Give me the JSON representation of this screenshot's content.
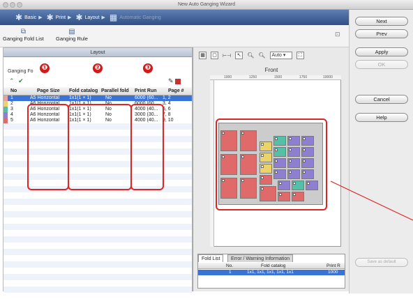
{
  "window": {
    "title": "New Auto Ganging Wizard"
  },
  "steps": [
    {
      "label": "Basic"
    },
    {
      "label": "Print"
    },
    {
      "label": "Layout"
    },
    {
      "label": "Automatic Ganging"
    }
  ],
  "toolbar": {
    "fold_list_label": "Ganging Fold List",
    "rule_label": "Ganging Rule"
  },
  "left_panel": {
    "header": "Layout",
    "section_label": "Ganging Fo"
  },
  "markers": [
    "❶",
    "❷",
    "❸"
  ],
  "table": {
    "columns": [
      "No",
      "Page Size",
      "Fold catalog",
      "Parallel fold",
      "Print Run",
      "Page #"
    ],
    "rows": [
      {
        "no": "1",
        "page_size": "A5 Horizontal",
        "fold": "1x1(1 × 1)",
        "parallel": "No",
        "run": "6000 (60...",
        "pages": "1, 2",
        "color": "#e8a0a0",
        "selected": true
      },
      {
        "no": "2",
        "page_size": "A6 Horizontal",
        "fold": "1x1(1 × 1)",
        "parallel": "No",
        "run": "6000 (60...",
        "pages": "3, 4",
        "color": "#e9d36a",
        "selected": false
      },
      {
        "no": "3",
        "page_size": "A6 Horizontal",
        "fold": "1x1(1 × 1)",
        "parallel": "No",
        "run": "4000 (40...",
        "pages": "5, 6",
        "color": "#55c0a8",
        "selected": false
      },
      {
        "no": "4",
        "page_size": "A6 Horizontal",
        "fold": "1x1(1 × 1)",
        "parallel": "No",
        "run": "3000 (30...",
        "pages": "7, 8",
        "color": "#8f7fd0",
        "selected": false
      },
      {
        "no": "5",
        "page_size": "A6 Horizontal",
        "fold": "1x1(1 × 1)",
        "parallel": "No",
        "run": "4000 (40...",
        "pages": "9, 10",
        "color": "#e06a6a",
        "selected": false
      }
    ]
  },
  "preview": {
    "zoom_value": "Auto",
    "side_label": "Front",
    "ruler_ticks": [
      "1000",
      "1250",
      "1500",
      "1750",
      "10000"
    ]
  },
  "bottom": {
    "tab_fold_list": "Fold List",
    "tab_errors": "Error / Warning Information",
    "headers": [
      "No.",
      "Fold catalog",
      "Print R"
    ],
    "row": {
      "no": "1",
      "catalog": "1x1, 1x1, 1x1, 1x1, 1x1",
      "run": "1000"
    }
  },
  "buttons": {
    "next": "Next",
    "prev": "Prev",
    "apply": "Apply",
    "ok": "OK",
    "cancel": "Cancel",
    "help": "Help",
    "bottom_disabled": "Save as default"
  },
  "colors": {
    "accent": "#3a73d6",
    "callout": "#e02424"
  }
}
